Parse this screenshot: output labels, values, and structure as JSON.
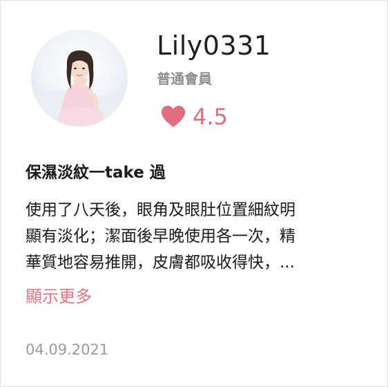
{
  "user": {
    "name": "Lily0331",
    "member_level": "普通會員",
    "rating": "4.5"
  },
  "review": {
    "title": "保濕淡紋一take 過",
    "body_lines": [
      "使用了八天後，眼角及眼肚位置細紋明",
      "顯有淡化；潔面後早晚使用各一次，精",
      "華質地容易推開，皮膚都吸收得快，..."
    ],
    "show_more_label": "顯示更多",
    "date": "04.09.2021"
  },
  "colors": {
    "accent": "#e06d7f",
    "show_more": "#e2737f",
    "muted_text": "#8e8e8e",
    "date_text": "#9b9b9b"
  },
  "icons": {
    "rating": "heart-icon"
  }
}
